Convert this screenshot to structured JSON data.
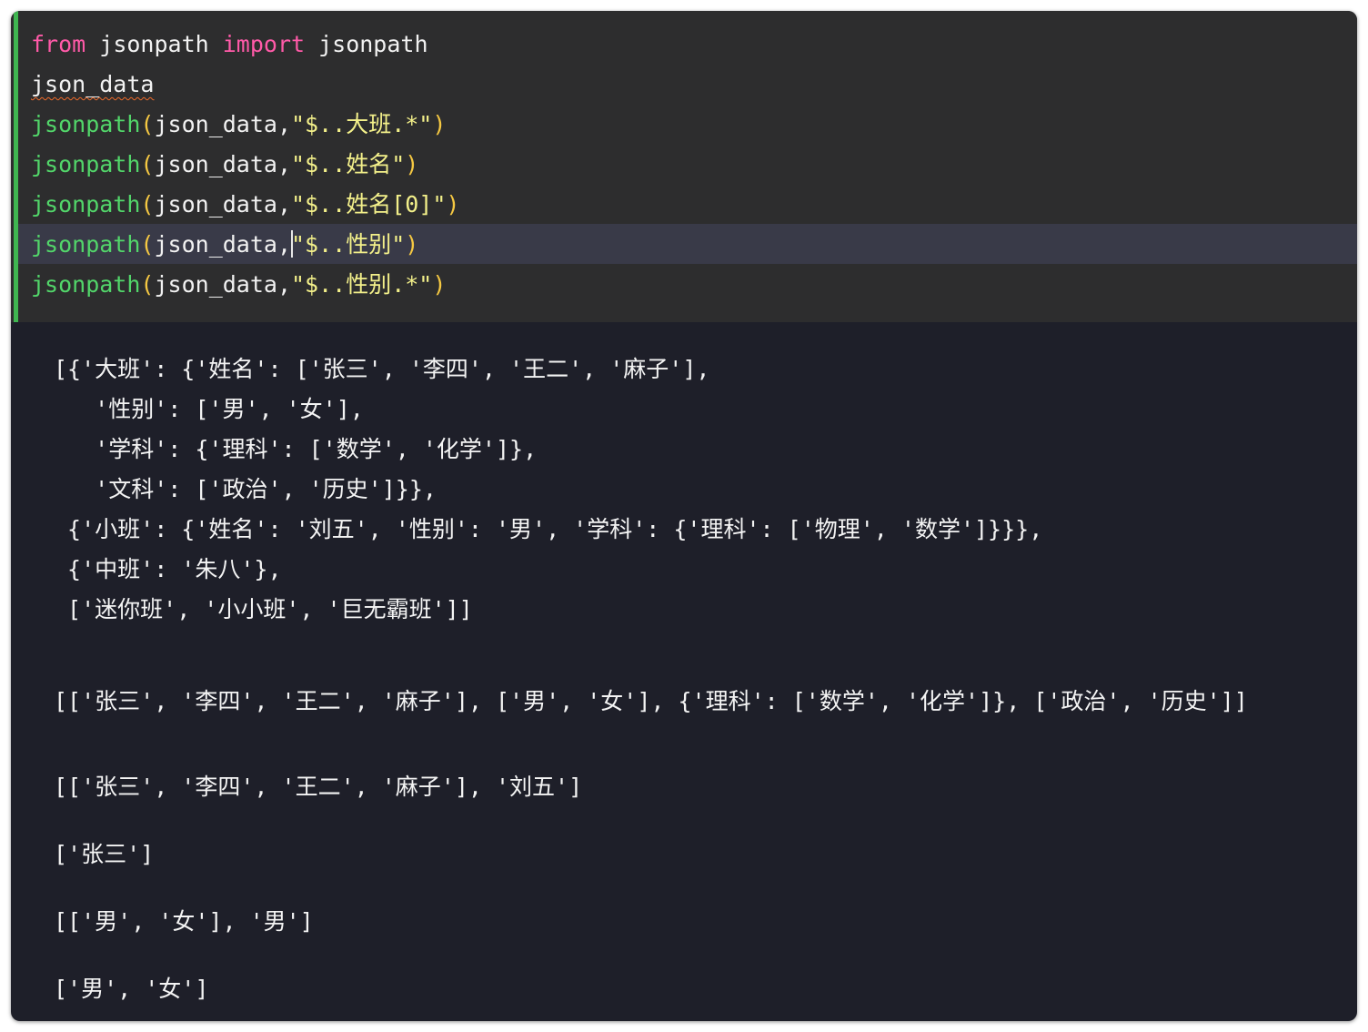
{
  "code_cell": {
    "lines": [
      [
        {
          "t": "from",
          "c": "kw"
        },
        {
          "t": " jsonpath ",
          "c": ""
        },
        {
          "t": "import",
          "c": "kw"
        },
        {
          "t": " jsonpath",
          "c": ""
        }
      ],
      [
        {
          "t": "json_data",
          "c": "squiggle"
        }
      ],
      [
        {
          "t": "jsonpath",
          "c": "fn"
        },
        {
          "t": "(",
          "c": "paren"
        },
        {
          "t": "json_data,",
          "c": ""
        },
        {
          "t": "\"$..大班.*\"",
          "c": "str"
        },
        {
          "t": ")",
          "c": "paren"
        }
      ],
      [
        {
          "t": "jsonpath",
          "c": "fn"
        },
        {
          "t": "(",
          "c": "paren"
        },
        {
          "t": "json_data,",
          "c": ""
        },
        {
          "t": "\"$..姓名\"",
          "c": "str"
        },
        {
          "t": ")",
          "c": "paren"
        }
      ],
      [
        {
          "t": "jsonpath",
          "c": "fn"
        },
        {
          "t": "(",
          "c": "paren"
        },
        {
          "t": "json_data,",
          "c": ""
        },
        {
          "t": "\"$..姓名[0]\"",
          "c": "str"
        },
        {
          "t": ")",
          "c": "paren"
        }
      ],
      [
        {
          "t": "jsonpath",
          "c": "fn"
        },
        {
          "t": "(",
          "c": "paren"
        },
        {
          "t": "json_data,",
          "c": ""
        },
        {
          "t": "",
          "c": "caret"
        },
        {
          "t": "\"$..性别\"",
          "c": "str"
        },
        {
          "t": ")",
          "c": "paren"
        }
      ],
      [
        {
          "t": "jsonpath",
          "c": "fn"
        },
        {
          "t": "(",
          "c": "paren"
        },
        {
          "t": "json_data,",
          "c": ""
        },
        {
          "t": "\"$..性别.*\"",
          "c": "str"
        },
        {
          "t": ")",
          "c": "paren"
        }
      ]
    ]
  },
  "output": {
    "lines": [
      "[{'大班': {'姓名': ['张三', '李四', '王二', '麻子'],",
      "   '性别': ['男', '女'],",
      "   '学科': {'理科': ['数学', '化学']},",
      "   '文科': ['政治', '历史']}},",
      " {'小班': {'姓名': '刘五', '性别': '男', '学科': {'理科': ['物理', '数学']}}},",
      " {'中班': '朱八'},",
      " ['迷你班', '小小班', '巨无霸班']]",
      "[['张三', '李四', '王二', '麻子'], ['男', '女'], {'理科': ['数学', '化学']}, ['政治', '历史']]",
      "[['张三', '李四', '王二', '麻子'], '刘五']",
      "['张三']",
      "[['男', '女'], '男']",
      "['男', '女']"
    ]
  },
  "colors": {
    "background": "#1e1f29",
    "code_cell_background": "#2d2d2e",
    "cell_indicator": "#3fb650",
    "active_line": "#393a48",
    "keyword": "#ff5aa8",
    "function": "#52d66a",
    "paren": "#f5c842",
    "string": "#f3f08a"
  }
}
